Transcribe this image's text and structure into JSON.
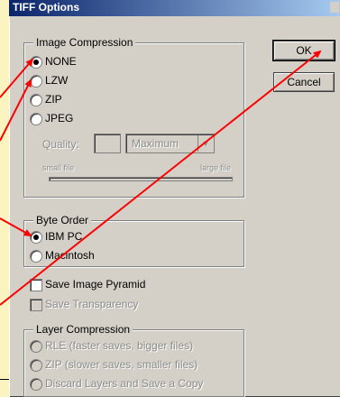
{
  "window": {
    "title": "TIFF Options"
  },
  "image_compression": {
    "label": "Image Compression",
    "options": [
      "NONE",
      "LZW",
      "ZIP",
      "JPEG"
    ],
    "selected": "NONE",
    "quality_label": "Quality:",
    "quality_value": "",
    "quality_preset": "Maximum",
    "small_file_label": "small file",
    "large_file_label": "large file"
  },
  "byte_order": {
    "label": "Byte Order",
    "options": [
      "IBM PC",
      "Macintosh"
    ],
    "selected": "IBM PC"
  },
  "checkboxes": {
    "save_pyramid": "Save Image Pyramid",
    "save_transparency": "Save Transparency"
  },
  "layer_compression": {
    "label": "Layer Compression",
    "options": [
      "RLE (faster saves, bigger files)",
      "ZIP (slower saves, smaller files)",
      "Discard Layers and Save a Copy"
    ]
  },
  "buttons": {
    "ok": "OK",
    "cancel": "Cancel"
  },
  "colors": {
    "dialog": "#d4d0c8",
    "titlebar": "#0a246a",
    "arrow": "#ff0000",
    "background": "#fcf4c0"
  },
  "icons": [
    "red-arrow-icon",
    "dropdown-arrow-icon"
  ]
}
